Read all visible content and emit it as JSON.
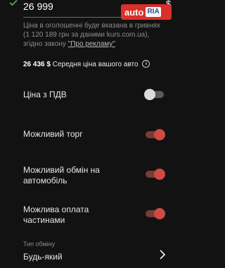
{
  "price": {
    "value": "26 999",
    "currency": "$"
  },
  "logo": {
    "auto": "auto",
    "ria": "RIA"
  },
  "note": {
    "text": "Ціна в оголошенні буде вказана в гривнях (1 120 189 грн за даними kurs.com.ua), згідно закону ",
    "link": "\"Про рекламу\""
  },
  "average": {
    "amount": "26 436 $",
    "label": "Середня ціна вашого авто"
  },
  "options": [
    {
      "label": "Ціна з ПДВ",
      "enabled": false
    },
    {
      "label": "Можливий торг",
      "enabled": true
    },
    {
      "label": "Можливий обмін на автомобіль",
      "enabled": true
    },
    {
      "label": "Можлива оплата частинами",
      "enabled": true
    }
  ],
  "exchange": {
    "label": "Тип обміну",
    "value": "Будь-який"
  },
  "icons": {
    "check": "check-icon",
    "info": "info-icon",
    "chevron": "chevron-right-icon"
  },
  "colors": {
    "accent": "#cf4a41",
    "brand": "#d9302a",
    "background": "#121212"
  }
}
